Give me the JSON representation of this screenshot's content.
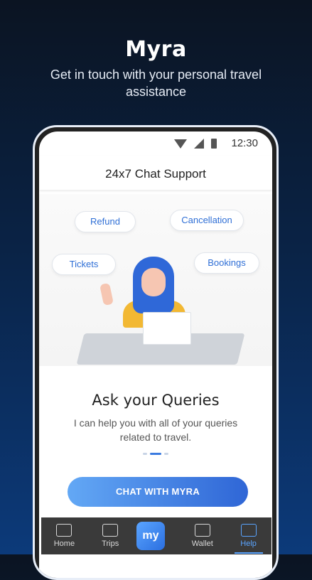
{
  "hero": {
    "title": "Myra",
    "subtitle": "Get in touch with your personal travel assistance"
  },
  "statusbar": {
    "time": "12:30"
  },
  "chat": {
    "header": "24x7 Chat Support",
    "chips": [
      "Refund",
      "Cancellation",
      "Tickets",
      "Bookings"
    ],
    "heading": "Ask your Queries",
    "description": "I can help you with all of your queries related to travel.",
    "cta": "CHAT WITH MYRA"
  },
  "tabs": [
    {
      "label": "Home",
      "icon": "home-icon"
    },
    {
      "label": "Trips",
      "icon": "suitcase-icon"
    },
    {
      "label": "my",
      "icon": "my-logo-icon"
    },
    {
      "label": "Wallet",
      "icon": "wallet-icon"
    },
    {
      "label": "Help",
      "icon": "chat-icon",
      "active": true
    }
  ],
  "colors": {
    "accent": "#2f66d6",
    "activeTab": "#5aa4ff",
    "chipText": "#2f6fd6"
  }
}
